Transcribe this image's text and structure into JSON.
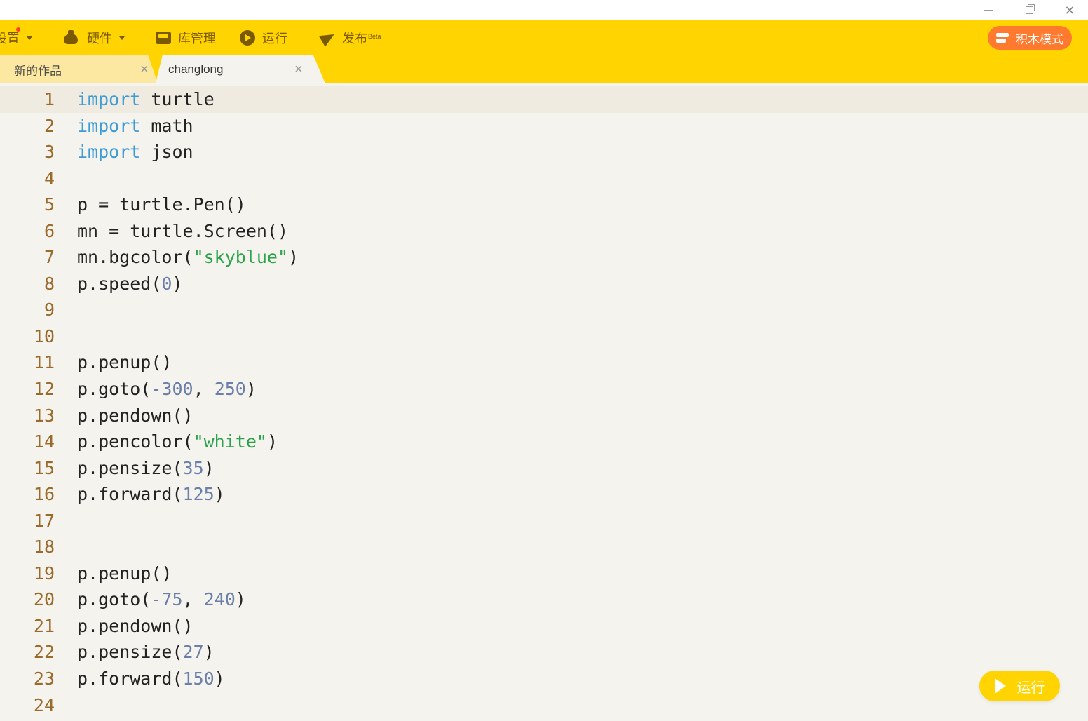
{
  "window": {
    "controls": [
      "minimize",
      "restore",
      "close"
    ]
  },
  "toolbar": {
    "settings_label": "设置",
    "hardware_label": "硬件",
    "library_label": "库管理",
    "run_label": "运行",
    "publish_label": "发布",
    "publish_badge": "Beta",
    "block_mode_label": "积木模式",
    "accent_color": "#ffd400",
    "block_mode_color": "#ff7a2e"
  },
  "tabs": [
    {
      "label": "新的作品",
      "active": false
    },
    {
      "label": "changlong",
      "active": true
    }
  ],
  "editor": {
    "active_line": 1,
    "lines": [
      {
        "n": "1"
      },
      {
        "n": "2"
      },
      {
        "n": "3"
      },
      {
        "n": "4"
      },
      {
        "n": "5"
      },
      {
        "n": "6"
      },
      {
        "n": "7"
      },
      {
        "n": "8"
      },
      {
        "n": "9"
      },
      {
        "n": "10"
      },
      {
        "n": "11"
      },
      {
        "n": "12"
      },
      {
        "n": "13"
      },
      {
        "n": "14"
      },
      {
        "n": "15"
      },
      {
        "n": "16"
      },
      {
        "n": "17"
      },
      {
        "n": "18"
      },
      {
        "n": "19"
      },
      {
        "n": "20"
      },
      {
        "n": "21"
      },
      {
        "n": "22"
      },
      {
        "n": "23"
      },
      {
        "n": "24"
      }
    ],
    "code": {
      "l1_kw": "import",
      "l1_rest": " turtle",
      "l2_kw": "import",
      "l2_rest": " math",
      "l3_kw": "import",
      "l3_rest": " json",
      "l5": "p = turtle.Pen()",
      "l6": "mn = turtle.Screen()",
      "l7_a": "mn.bgcolor(",
      "l7_str": "\"skyblue\"",
      "l7_b": ")",
      "l8_a": "p.speed(",
      "l8_num": "0",
      "l8_b": ")",
      "l11": "p.penup()",
      "l12_a": "p.goto(",
      "l12_n1": "-300",
      "l12_sep": ", ",
      "l12_n2": "250",
      "l12_b": ")",
      "l13": "p.pendown()",
      "l14_a": "p.pencolor(",
      "l14_str": "\"white\"",
      "l14_b": ")",
      "l15_a": "p.pensize(",
      "l15_num": "35",
      "l15_b": ")",
      "l16_a": "p.forward(",
      "l16_num": "125",
      "l16_b": ")",
      "l19": "p.penup()",
      "l20_a": "p.goto(",
      "l20_n1": "-75",
      "l20_sep": ", ",
      "l20_n2": "240",
      "l20_b": ")",
      "l21": "p.pendown()",
      "l22_a": "p.pensize(",
      "l22_num": "27",
      "l22_b": ")",
      "l23_a": "p.forward(",
      "l23_num": "150",
      "l23_b": ")"
    }
  },
  "run_button": {
    "label": "运行"
  }
}
